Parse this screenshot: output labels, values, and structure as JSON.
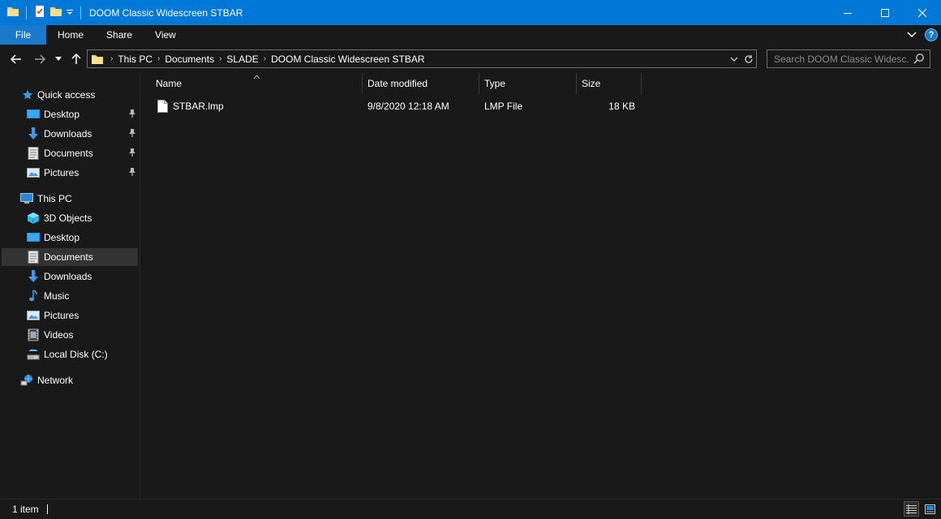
{
  "window": {
    "title": "DOOM Classic Widescreen STBAR"
  },
  "ribbon": {
    "tabs": [
      {
        "label": "File"
      },
      {
        "label": "Home"
      },
      {
        "label": "Share"
      },
      {
        "label": "View"
      }
    ],
    "help_label": "?"
  },
  "address": {
    "crumbs": [
      "This PC",
      "Documents",
      "SLADE",
      "DOOM Classic Widescreen STBAR"
    ],
    "search_placeholder": "Search DOOM Classic Widesc..."
  },
  "nav": {
    "quick_access": {
      "label": "Quick access",
      "items": [
        {
          "label": "Desktop",
          "icon": "desktop-icon",
          "pinned": true
        },
        {
          "label": "Downloads",
          "icon": "downloads-icon",
          "pinned": true
        },
        {
          "label": "Documents",
          "icon": "documents-icon",
          "pinned": true
        },
        {
          "label": "Pictures",
          "icon": "pictures-icon",
          "pinned": true
        }
      ]
    },
    "this_pc": {
      "label": "This PC",
      "items": [
        {
          "label": "3D Objects",
          "icon": "3d-objects-icon"
        },
        {
          "label": "Desktop",
          "icon": "desktop-icon"
        },
        {
          "label": "Documents",
          "icon": "documents-icon",
          "selected": true
        },
        {
          "label": "Downloads",
          "icon": "downloads-icon"
        },
        {
          "label": "Music",
          "icon": "music-icon"
        },
        {
          "label": "Pictures",
          "icon": "pictures-icon"
        },
        {
          "label": "Videos",
          "icon": "videos-icon"
        },
        {
          "label": "Local Disk (C:)",
          "icon": "drive-icon"
        }
      ]
    },
    "network": {
      "label": "Network"
    }
  },
  "columns": {
    "name": "Name",
    "date": "Date modified",
    "type": "Type",
    "size": "Size"
  },
  "files": [
    {
      "name": "STBAR.lmp",
      "date": "9/8/2020 12:18 AM",
      "type": "LMP File",
      "size": "18 KB"
    }
  ],
  "status": {
    "count": "1 item"
  },
  "colors": {
    "titlebar": "#0078d7",
    "file_tab": "#1979ca",
    "background": "#191919",
    "selected": "#333333"
  }
}
